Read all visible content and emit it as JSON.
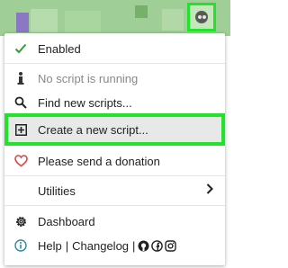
{
  "colors": {
    "accent_green": "#22e32b",
    "check_green": "#3a9a3a",
    "heart_red": "#e04848",
    "info_teal": "#2b8ca3",
    "muted_text": "#888888"
  },
  "extension_button": {
    "icon": "tampermonkey-icon"
  },
  "menu": {
    "enabled": {
      "label": "Enabled",
      "icon": "check-icon"
    },
    "status": {
      "label": "No script is running",
      "icon": "script-info-icon"
    },
    "find": {
      "label": "Find new scripts...",
      "icon": "search-icon"
    },
    "create": {
      "label": "Create a new script...",
      "icon": "plus-square-icon"
    },
    "donate": {
      "label": "Please send a donation",
      "icon": "heart-icon"
    },
    "utilities": {
      "label": "Utilities",
      "icon": "chevron-right-icon"
    },
    "dashboard": {
      "label": "Dashboard",
      "icon": "gear-icon"
    },
    "footer": {
      "help": "Help",
      "divider": "|",
      "changelog": "Changelog",
      "divider2": "|",
      "icons": [
        "info-icon",
        "github-icon",
        "facebook-icon",
        "instagram-icon"
      ]
    }
  }
}
